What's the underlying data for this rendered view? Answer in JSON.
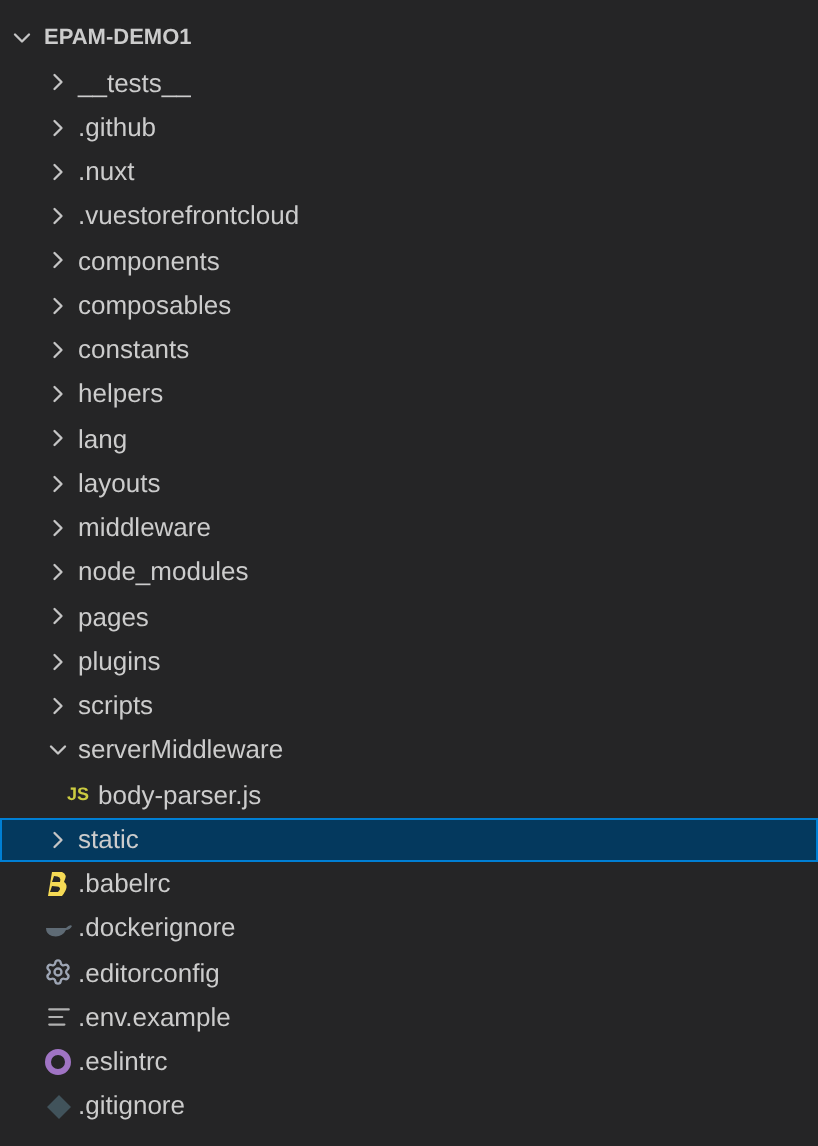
{
  "explorer": {
    "root": {
      "label": "EPAM-DEMO1",
      "expanded": true,
      "children": [
        {
          "label": "__tests__",
          "kind": "folder",
          "expanded": false,
          "selected": false
        },
        {
          "label": ".github",
          "kind": "folder",
          "expanded": false,
          "selected": false
        },
        {
          "label": ".nuxt",
          "kind": "folder",
          "expanded": false,
          "selected": false
        },
        {
          "label": ".vuestorefrontcloud",
          "kind": "folder",
          "expanded": false,
          "selected": false
        },
        {
          "label": "components",
          "kind": "folder",
          "expanded": false,
          "selected": false
        },
        {
          "label": "composables",
          "kind": "folder",
          "expanded": false,
          "selected": false
        },
        {
          "label": "constants",
          "kind": "folder",
          "expanded": false,
          "selected": false
        },
        {
          "label": "helpers",
          "kind": "folder",
          "expanded": false,
          "selected": false
        },
        {
          "label": "lang",
          "kind": "folder",
          "expanded": false,
          "selected": false
        },
        {
          "label": "layouts",
          "kind": "folder",
          "expanded": false,
          "selected": false
        },
        {
          "label": "middleware",
          "kind": "folder",
          "expanded": false,
          "selected": false
        },
        {
          "label": "node_modules",
          "kind": "folder",
          "expanded": false,
          "selected": false
        },
        {
          "label": "pages",
          "kind": "folder",
          "expanded": false,
          "selected": false
        },
        {
          "label": "plugins",
          "kind": "folder",
          "expanded": false,
          "selected": false
        },
        {
          "label": "scripts",
          "kind": "folder",
          "expanded": false,
          "selected": false
        },
        {
          "label": "serverMiddleware",
          "kind": "folder",
          "expanded": true,
          "selected": false,
          "children": [
            {
              "label": "body-parser.js",
              "kind": "js",
              "icon_text": "JS",
              "selected": false
            }
          ]
        },
        {
          "label": "static",
          "kind": "folder",
          "expanded": false,
          "selected": true
        },
        {
          "label": ".babelrc",
          "kind": "babel",
          "selected": false
        },
        {
          "label": ".dockerignore",
          "kind": "docker",
          "selected": false
        },
        {
          "label": ".editorconfig",
          "kind": "config",
          "selected": false
        },
        {
          "label": ".env.example",
          "kind": "text",
          "selected": false
        },
        {
          "label": ".eslintrc",
          "kind": "eslint",
          "selected": false
        },
        {
          "label": ".gitignore",
          "kind": "git",
          "selected": false
        }
      ]
    }
  }
}
